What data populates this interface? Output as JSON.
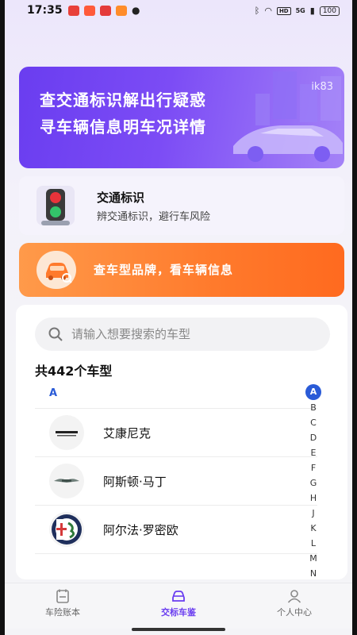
{
  "status_bar": {
    "time": "17:35",
    "signal_label": "5G",
    "hd_label": "HD",
    "battery": "100"
  },
  "banner": {
    "line1": "查交通标识解出行疑惑",
    "line2": "寻车辆信息明车况详情",
    "tag": "ik83",
    "colors": {
      "start": "#6a3df0",
      "end": "#a482f7"
    }
  },
  "sign_card": {
    "title": "交通标识",
    "subtitle": "辨交通标识，避行车风险",
    "icon": "traffic-light-icon"
  },
  "brand_card": {
    "text": "查车型品牌，看车辆信息",
    "icon": "car-search-icon",
    "color": "#ff7a2c"
  },
  "search": {
    "placeholder": "请输入想要搜索的车型"
  },
  "list": {
    "count_label": "共442个车型",
    "section": "A",
    "items": [
      {
        "name": "艾康尼克",
        "logo": "icona-logo-icon"
      },
      {
        "name": "阿斯顿·马丁",
        "logo": "aston-martin-logo-icon"
      },
      {
        "name": "阿尔法·罗密欧",
        "logo": "alfa-romeo-logo-icon"
      }
    ]
  },
  "alpha_index": [
    "A",
    "B",
    "C",
    "D",
    "E",
    "F",
    "G",
    "H",
    "J",
    "K",
    "L",
    "M",
    "N"
  ],
  "nav": {
    "items": [
      {
        "label": "车险账本",
        "icon": "ledger-icon",
        "active": false
      },
      {
        "label": "交标车鉴",
        "icon": "car-icon",
        "active": true
      },
      {
        "label": "个人中心",
        "icon": "person-icon",
        "active": false
      }
    ],
    "active_color": "#6a3df0"
  }
}
